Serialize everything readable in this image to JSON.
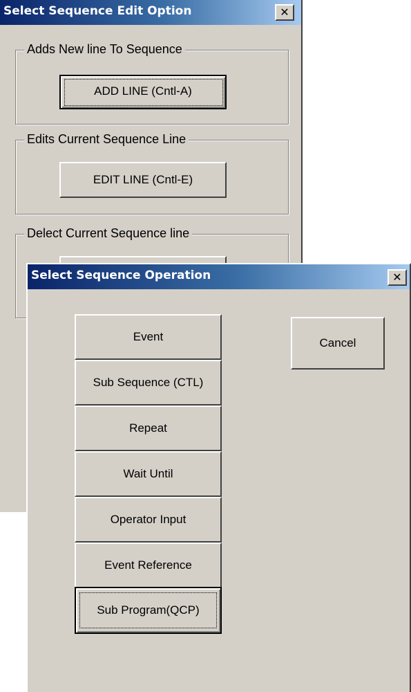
{
  "edit_dialog": {
    "title": "Select Sequence Edit Option",
    "close_glyph": "✕",
    "groups": [
      {
        "caption": "Adds New line To Sequence",
        "button_label": "ADD LINE (Cntl-A)"
      },
      {
        "caption": "Edits Current Sequence Line",
        "button_label": "EDIT LINE (Cntl-E)"
      },
      {
        "caption": "Delect Current Sequence line"
      }
    ]
  },
  "operation_dialog": {
    "title": "Select Sequence Operation",
    "close_glyph": "✕",
    "buttons": [
      {
        "label": "Event"
      },
      {
        "label": "Sub Sequence (CTL)"
      },
      {
        "label": "Repeat"
      },
      {
        "label": "Wait Until"
      },
      {
        "label": "Operator Input"
      },
      {
        "label": "Event Reference"
      },
      {
        "label": "Sub Program(QCP)"
      }
    ],
    "cancel_label": "Cancel"
  }
}
